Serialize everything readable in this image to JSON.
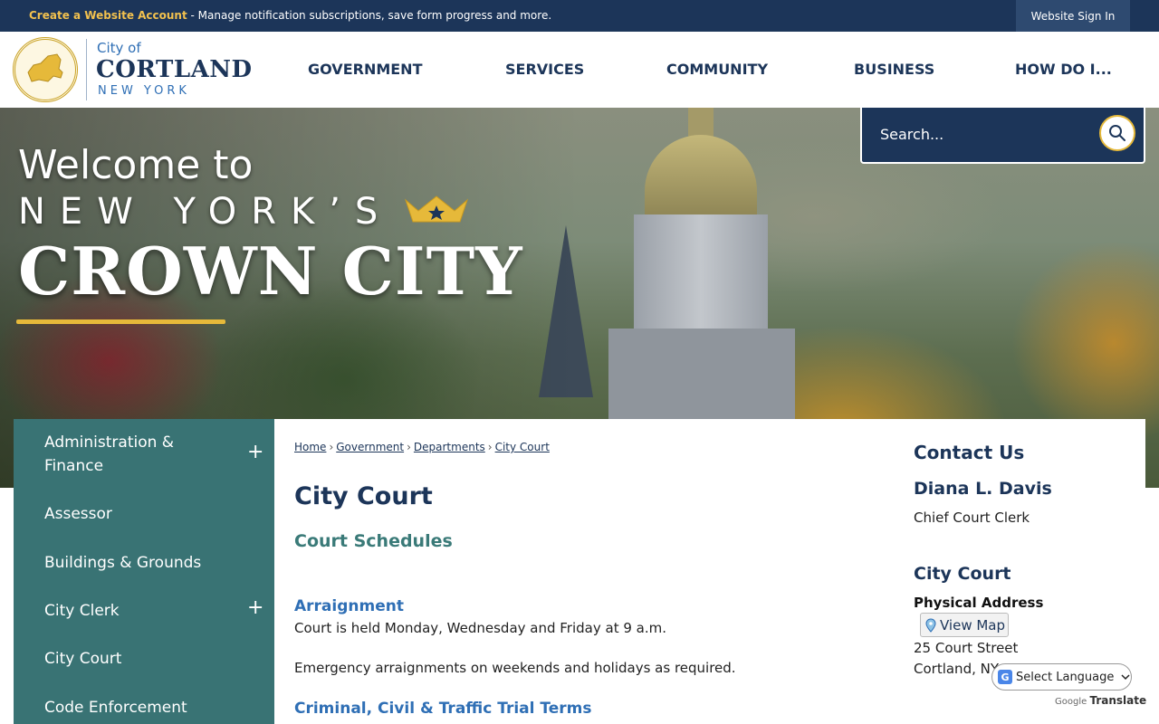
{
  "topbar": {
    "create_account": "Create a Website Account",
    "message": " - Manage notification subscriptions, save form progress and more.",
    "signin": "Website Sign In"
  },
  "logo": {
    "city_of": "City of",
    "name": "CORTLAND",
    "state": "NEW YORK"
  },
  "nav": {
    "items": [
      "GOVERNMENT",
      "SERVICES",
      "COMMUNITY",
      "BUSINESS",
      "HOW DO I..."
    ]
  },
  "hero": {
    "welcome": "Welcome to",
    "nys": "NEW YORK’S",
    "crown_city": "CROWN CITY"
  },
  "search": {
    "placeholder": "Search..."
  },
  "sidebar": {
    "items": [
      {
        "label": "Administration & Finance",
        "expandable": "+"
      },
      {
        "label": "Assessor"
      },
      {
        "label": "Buildings & Grounds"
      },
      {
        "label": "City Clerk",
        "expandable": "+"
      },
      {
        "label": "City Court"
      },
      {
        "label": "Code Enforcement"
      }
    ]
  },
  "breadcrumb": [
    "Home",
    "Government",
    "Departments",
    "City Court"
  ],
  "main": {
    "title": "City Court",
    "subtitle": "Court Schedules",
    "arraignment_title": "Arraignment",
    "arraignment_line1": "Court is held Monday, Wednesday and Friday at 9 a.m.",
    "arraignment_line2": "Emergency arraignments on weekends and holidays as required.",
    "trial_title": "Criminal, Civil & Traffic Trial Terms"
  },
  "contact": {
    "heading": "Contact Us",
    "name": "Diana L. Davis",
    "role": "Chief Court Clerk",
    "office": "City Court",
    "physical_label": "Physical Address",
    "view_map": "View Map",
    "street": "25 Court Street",
    "city": "Cortland, NY"
  },
  "translate": {
    "select": "Select Language",
    "powered_prefix": "Google",
    "powered_word": "Translate"
  },
  "colors": {
    "navy": "#1c3559",
    "teal": "#397374",
    "gold": "#e6b93a",
    "link_blue": "#2f6fb5"
  }
}
